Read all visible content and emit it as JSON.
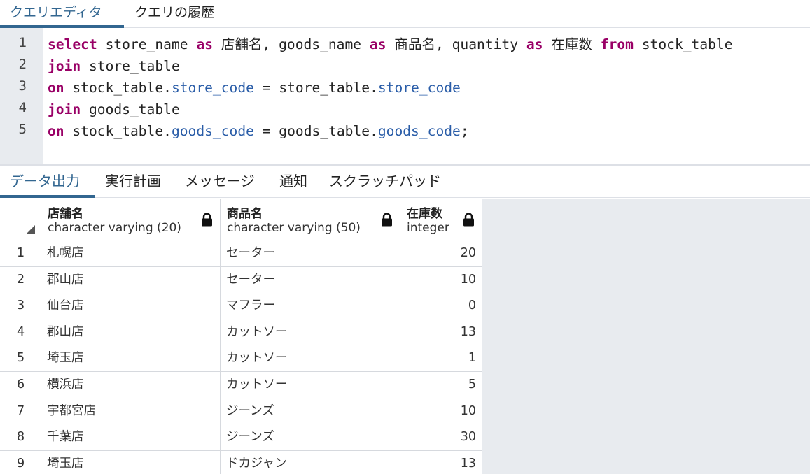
{
  "editor_tabs": [
    {
      "label": "クエリエディタ",
      "active": true
    },
    {
      "label": "クエリの履歴",
      "active": false
    }
  ],
  "editor": {
    "line_numbers": [
      "1",
      "2",
      "3",
      "4",
      "5"
    ],
    "lines": [
      [
        {
          "t": "select",
          "k": "kw"
        },
        {
          "t": " store_name ",
          "k": ""
        },
        {
          "t": "as",
          "k": "kw"
        },
        {
          "t": " 店舗名, goods_name ",
          "k": ""
        },
        {
          "t": "as",
          "k": "kw"
        },
        {
          "t": " 商品名, quantity ",
          "k": ""
        },
        {
          "t": "as",
          "k": "kw"
        },
        {
          "t": " 在庫数 ",
          "k": ""
        },
        {
          "t": "from",
          "k": "kw"
        },
        {
          "t": " stock_table",
          "k": ""
        }
      ],
      [
        {
          "t": "join",
          "k": "kw"
        },
        {
          "t": " store_table",
          "k": ""
        }
      ],
      [
        {
          "t": "on",
          "k": "kw"
        },
        {
          "t": " stock_table.",
          "k": ""
        },
        {
          "t": "store_code",
          "k": "prop"
        },
        {
          "t": " = store_table.",
          "k": ""
        },
        {
          "t": "store_code",
          "k": "prop"
        }
      ],
      [
        {
          "t": "join",
          "k": "kw"
        },
        {
          "t": " goods_table",
          "k": ""
        }
      ],
      [
        {
          "t": "on",
          "k": "kw"
        },
        {
          "t": " stock_table.",
          "k": ""
        },
        {
          "t": "goods_code",
          "k": "prop"
        },
        {
          "t": " = goods_table.",
          "k": ""
        },
        {
          "t": "goods_code",
          "k": "prop"
        },
        {
          "t": ";",
          "k": ""
        }
      ]
    ]
  },
  "result_tabs": [
    {
      "label": "データ出力",
      "active": true
    },
    {
      "label": "実行計画",
      "active": false
    },
    {
      "label": "メッセージ",
      "active": false
    },
    {
      "label": "通知",
      "active": false
    },
    {
      "label": "スクラッチパッド",
      "active": false
    }
  ],
  "grid": {
    "columns": [
      {
        "name": "店舗名",
        "type": "character varying (20)"
      },
      {
        "name": "商品名",
        "type": "character varying (50)"
      },
      {
        "name": "在庫数",
        "type": "integer"
      }
    ],
    "rows": [
      {
        "num": "1",
        "store": "札幌店",
        "goods": "セーター",
        "qty": "20"
      },
      {
        "num": "2",
        "store": "郡山店",
        "goods": "セーター",
        "qty": "10"
      },
      {
        "num": "3",
        "store": "仙台店",
        "goods": "マフラー",
        "qty": "0"
      },
      {
        "num": "4",
        "store": "郡山店",
        "goods": "カットソー",
        "qty": "13"
      },
      {
        "num": "5",
        "store": "埼玉店",
        "goods": "カットソー",
        "qty": "1"
      },
      {
        "num": "6",
        "store": "横浜店",
        "goods": "カットソー",
        "qty": "5"
      },
      {
        "num": "7",
        "store": "宇都宮店",
        "goods": "ジーンズ",
        "qty": "10"
      },
      {
        "num": "8",
        "store": "千葉店",
        "goods": "ジーンズ",
        "qty": "30"
      },
      {
        "num": "9",
        "store": "埼玉店",
        "goods": "ドカジャン",
        "qty": "13"
      }
    ]
  },
  "colors": {
    "accent": "#326690",
    "keyword": "#990066",
    "property": "#2a5da8",
    "gutter_bg": "#e8ebef"
  }
}
